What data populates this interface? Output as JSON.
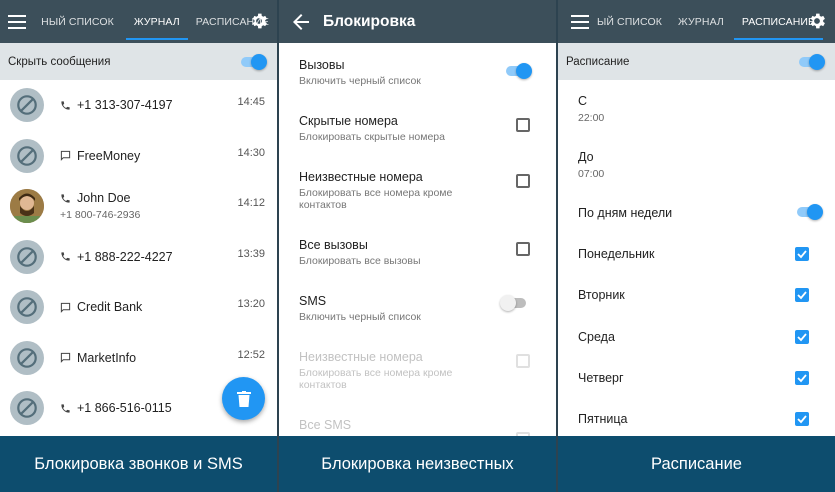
{
  "panel1": {
    "tabs": [
      "ный список",
      "Журнал",
      "Расписание"
    ],
    "active_tab": 1,
    "filter_label": "Скрыть сообщения",
    "entries": [
      {
        "type": "call",
        "name": "+1 313-307-4197",
        "sub": "",
        "time": "14:45",
        "avatar": "blocked"
      },
      {
        "type": "sms",
        "name": "FreeMoney",
        "sub": "",
        "time": "14:30",
        "avatar": "blocked"
      },
      {
        "type": "call",
        "name": "John Doe",
        "sub": "+1 800-746-2936",
        "time": "14:12",
        "avatar": "photo"
      },
      {
        "type": "call",
        "name": "+1 888-222-4227",
        "sub": "",
        "time": "13:39",
        "avatar": "blocked"
      },
      {
        "type": "sms",
        "name": "Credit Bank",
        "sub": "",
        "time": "13:20",
        "avatar": "blocked"
      },
      {
        "type": "sms",
        "name": "MarketInfo",
        "sub": "",
        "time": "12:52",
        "avatar": "blocked"
      },
      {
        "type": "call",
        "name": "+1 866-516-0115",
        "sub": "",
        "time": "",
        "avatar": "blocked"
      }
    ],
    "banner": "Блокировка звонков и SMS"
  },
  "panel2": {
    "title": "Блокировка",
    "items": [
      {
        "title": "Вызовы",
        "sub": "Включить черный список",
        "control": "toggle-on",
        "disabled": false
      },
      {
        "title": "Скрытые номера",
        "sub": "Блокировать скрытые номера",
        "control": "checkbox",
        "disabled": false
      },
      {
        "title": "Неизвестные номера",
        "sub": "Блокировать все номера кроме контактов",
        "control": "checkbox",
        "disabled": false
      },
      {
        "title": "Все вызовы",
        "sub": "Блокировать все вызовы",
        "control": "checkbox",
        "disabled": false
      },
      {
        "title": "SMS",
        "sub": "Включить черный список",
        "control": "toggle-off",
        "disabled": false
      },
      {
        "title": "Неизвестные номера",
        "sub": "Блокировать все номера кроме контактов",
        "control": "checkbox",
        "disabled": true
      },
      {
        "title": "Все SMS",
        "sub": "",
        "control": "checkbox",
        "disabled": true
      }
    ],
    "banner": "Блокировка неизвестных"
  },
  "panel3": {
    "tabs": [
      "ый список",
      "Журнал",
      "Расписание"
    ],
    "active_tab": 2,
    "filter_label": "Расписание",
    "from_label": "С",
    "from_value": "22:00",
    "to_label": "До",
    "to_value": "07:00",
    "weekdays_label": "По дням недели",
    "days": [
      "Понедельник",
      "Вторник",
      "Среда",
      "Четверг",
      "Пятница"
    ],
    "banner": "Расписание"
  },
  "colors": {
    "appbar": "#3c4f5a",
    "accent": "#2196f3",
    "banner": "#0d4d6e"
  }
}
